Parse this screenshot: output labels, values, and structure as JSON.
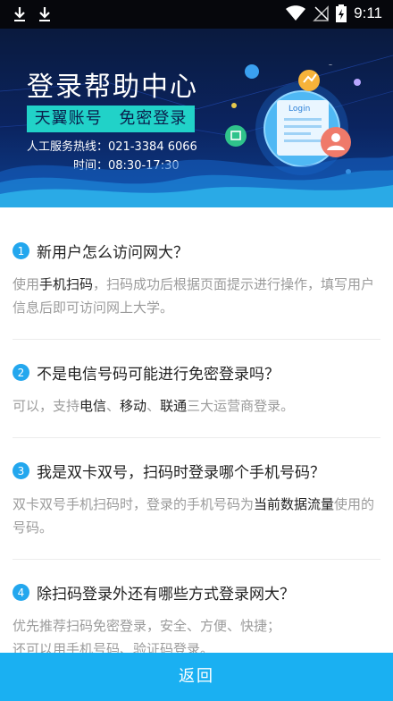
{
  "status_bar": {
    "time": "9:11"
  },
  "banner": {
    "title": "登录帮助中心",
    "tag_left": "天翼账号",
    "tag_right": "免密登录",
    "hotline": "人工服务热线：021-3384 6066",
    "hours": "时间：08:30-17:30",
    "login_card_label": "Login"
  },
  "faqs": [
    {
      "num": "1",
      "question": "新用户怎么访问网大？",
      "answer": [
        {
          "t": "使用"
        },
        {
          "t": "手机扫码",
          "b": true
        },
        {
          "t": "，扫码成功后根据页面提示进行操作，填写用户信息后即可访问网上大学。"
        }
      ]
    },
    {
      "num": "2",
      "question": "不是电信号码可能进行免密登录吗？",
      "answer": [
        {
          "t": "可以，支持"
        },
        {
          "t": "电信",
          "b": true
        },
        {
          "t": "、"
        },
        {
          "t": "移动",
          "b": true
        },
        {
          "t": "、"
        },
        {
          "t": "联通",
          "b": true
        },
        {
          "t": "三大运营商登录。"
        }
      ]
    },
    {
      "num": "3",
      "question": "我是双卡双号，扫码时登录哪个手机号码？",
      "answer": [
        {
          "t": "双卡双号手机扫码时，登录的手机号码为"
        },
        {
          "t": "当前数据流量",
          "b": true
        },
        {
          "t": "使用的号码。"
        }
      ]
    },
    {
      "num": "4",
      "question": "除扫码登录外还有哪些方式登录网大？",
      "answer": [
        {
          "t": "优先推荐扫码免密登录，安全、方便、快捷；"
        },
        {
          "t": "\n"
        },
        {
          "t": "还可以用手机号码、验证码登录。"
        }
      ]
    }
  ],
  "footer": {
    "back_label": "返回"
  }
}
